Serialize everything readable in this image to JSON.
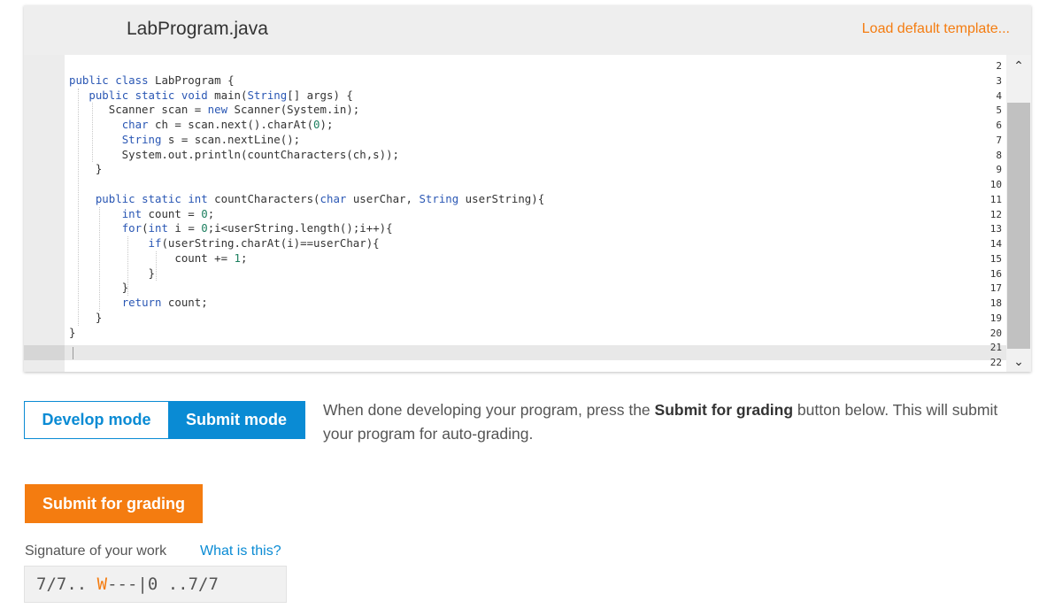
{
  "editor": {
    "file_name": "LabProgram.java",
    "load_template_label": "Load default template...",
    "line_numbers": [
      "2",
      "3",
      "4",
      "5",
      "6",
      "7",
      "8",
      "9",
      "10",
      "11",
      "12",
      "13",
      "14",
      "15",
      "16",
      "17",
      "18",
      "19",
      "20",
      "21",
      "22"
    ],
    "code_lines": [
      "",
      "public class LabProgram {",
      "   public static void main(String[] args) {",
      "      Scanner scan = new Scanner(System.in);",
      "        char ch = scan.next().charAt(0);",
      "        String s = scan.nextLine();",
      "        System.out.println(countCharacters(ch,s));",
      "    }",
      "",
      "    public static int countCharacters(char userChar, String userString){",
      "        int count = 0;",
      "        for(int i = 0;i<userString.length();i++){",
      "            if(userString.charAt(i)==userChar){",
      "                count += 1;",
      "            }",
      "        }",
      "        return count;",
      "    }",
      "}",
      "",
      ""
    ]
  },
  "modes": {
    "develop_label": "Develop mode",
    "submit_label": "Submit mode",
    "selected": "Submit mode"
  },
  "instructions": {
    "before": "When done developing your program, press the ",
    "bold": "Submit for grading",
    "after": " button below. This will submit your program for auto-grading."
  },
  "submit_button_label": "Submit for grading",
  "signature": {
    "label": "Signature of your work",
    "help_link": "What is this?",
    "value_start": "7/7.. ",
    "value_w": "W",
    "value_end": "---|0 ..7/7"
  },
  "colors": {
    "accent_blue": "#0a8bd4",
    "accent_orange": "#f47c10",
    "keyword": "#2a57b4",
    "number": "#1d7f5f"
  },
  "icons": {
    "scroll_up": "chevron-up-icon",
    "scroll_down": "chevron-down-icon"
  }
}
